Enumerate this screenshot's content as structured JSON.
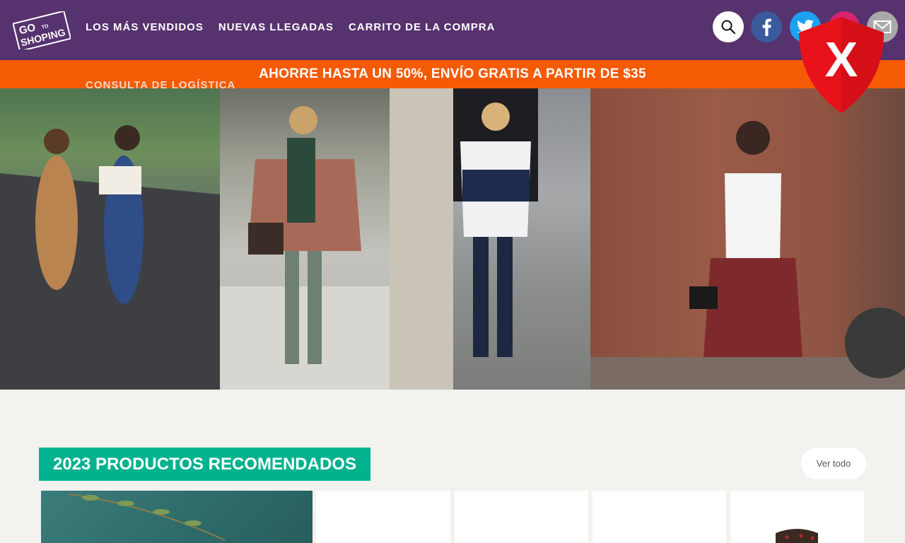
{
  "header": {
    "logo_top": "GO",
    "logo_mid": "TO",
    "logo_bottom": "SHOPING",
    "nav": [
      {
        "label": "LOS MÁS VENDIDOS"
      },
      {
        "label": "NUEVAS LLEGADAS"
      },
      {
        "label": "CARRITO DE LA COMPRA"
      },
      {
        "label": "CONSULTA DE LOGÍSTICA"
      }
    ],
    "icons": [
      "search-icon",
      "facebook-icon",
      "twitter-icon",
      "instagram-icon",
      "mail-icon"
    ]
  },
  "promo": {
    "text": "AHORRE HASTA UN 50%, ENVÍO GRATIS A PARTIR DE $35"
  },
  "overlay": {
    "shield_letter": "X"
  },
  "section": {
    "title": "2023 PRODUCTOS RECOMENDADOS",
    "view_all": "Ver todo"
  },
  "colors": {
    "header_bg": "#56326e",
    "promo_bg": "#f55a05",
    "section_title_bg": "#00b28e",
    "shield_red": "#e8121b",
    "page_bg": "#f2f2ee"
  }
}
